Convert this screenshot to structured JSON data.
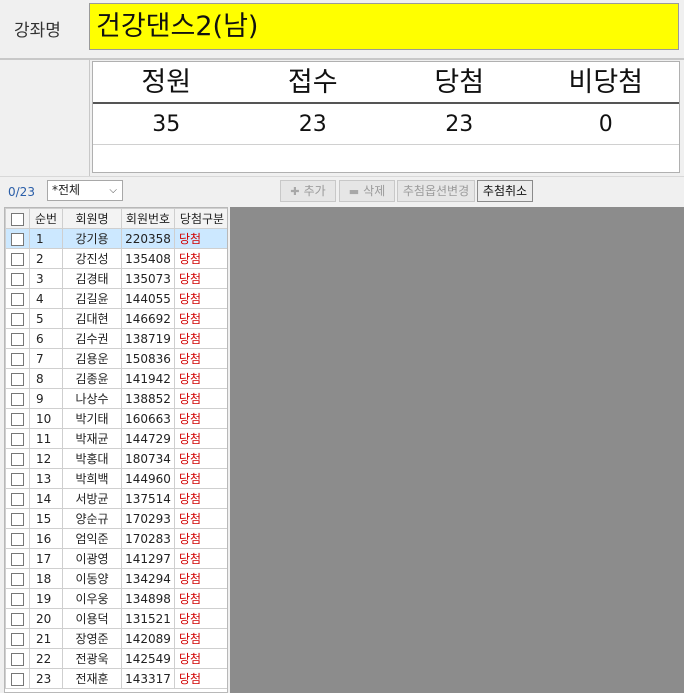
{
  "course": {
    "label": "강좌명",
    "name": "건강댄스2(남)"
  },
  "stats": {
    "headers": [
      "정원",
      "접수",
      "당첨",
      "비당첨"
    ],
    "values": [
      "35",
      "23",
      "23",
      "0"
    ]
  },
  "toolbar": {
    "count": "0/23",
    "filter": "*전체",
    "add": "추가",
    "delete": "삭제",
    "draw_option": "추첨옵션변경",
    "cancel_draw": "추첨취소"
  },
  "grid": {
    "headers": [
      "순번",
      "회원명",
      "회원번호",
      "당첨구분"
    ],
    "rows": [
      {
        "seq": "1",
        "name": "강기용",
        "id": "220358",
        "status": "당첨"
      },
      {
        "seq": "2",
        "name": "강진성",
        "id": "135408",
        "status": "당첨"
      },
      {
        "seq": "3",
        "name": "김경태",
        "id": "135073",
        "status": "당첨"
      },
      {
        "seq": "4",
        "name": "김길윤",
        "id": "144055",
        "status": "당첨"
      },
      {
        "seq": "5",
        "name": "김대현",
        "id": "146692",
        "status": "당첨"
      },
      {
        "seq": "6",
        "name": "김수권",
        "id": "138719",
        "status": "당첨"
      },
      {
        "seq": "7",
        "name": "김용운",
        "id": "150836",
        "status": "당첨"
      },
      {
        "seq": "8",
        "name": "김종윤",
        "id": "141942",
        "status": "당첨"
      },
      {
        "seq": "9",
        "name": "나상수",
        "id": "138852",
        "status": "당첨"
      },
      {
        "seq": "10",
        "name": "박기태",
        "id": "160663",
        "status": "당첨"
      },
      {
        "seq": "11",
        "name": "박재균",
        "id": "144729",
        "status": "당첨"
      },
      {
        "seq": "12",
        "name": "박홍대",
        "id": "180734",
        "status": "당첨"
      },
      {
        "seq": "13",
        "name": "박희백",
        "id": "144960",
        "status": "당첨"
      },
      {
        "seq": "14",
        "name": "서방균",
        "id": "137514",
        "status": "당첨"
      },
      {
        "seq": "15",
        "name": "양순규",
        "id": "170293",
        "status": "당첨"
      },
      {
        "seq": "16",
        "name": "엄익준",
        "id": "170283",
        "status": "당첨"
      },
      {
        "seq": "17",
        "name": "이광영",
        "id": "141297",
        "status": "당첨"
      },
      {
        "seq": "18",
        "name": "이동양",
        "id": "134294",
        "status": "당첨"
      },
      {
        "seq": "19",
        "name": "이우웅",
        "id": "134898",
        "status": "당첨"
      },
      {
        "seq": "20",
        "name": "이용덕",
        "id": "131521",
        "status": "당첨"
      },
      {
        "seq": "21",
        "name": "장영준",
        "id": "142089",
        "status": "당첨"
      },
      {
        "seq": "22",
        "name": "전광욱",
        "id": "142549",
        "status": "당첨"
      },
      {
        "seq": "23",
        "name": "전재훈",
        "id": "143317",
        "status": "당첨"
      }
    ]
  }
}
